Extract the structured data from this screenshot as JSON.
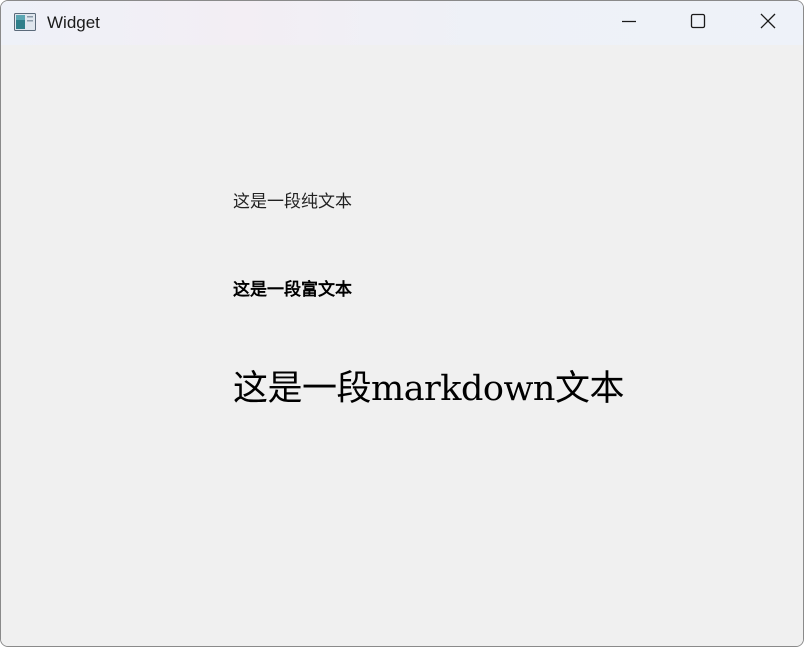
{
  "window": {
    "title": "Widget",
    "app_icon": "qt-window-icon",
    "controls": {
      "minimize": "minimize-icon",
      "maximize": "maximize-icon",
      "close": "close-icon"
    }
  },
  "content": {
    "plain_text": "这是一段纯文本",
    "rich_text": "这是一段富文本",
    "markdown_text": "这是一段markdown文本"
  },
  "colors": {
    "background": "#f0f0f0",
    "text": "#000000"
  }
}
